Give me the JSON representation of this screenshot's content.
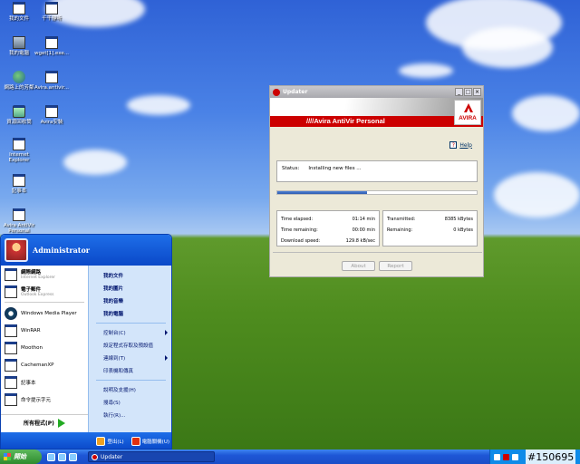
{
  "desktop": {
    "icons": [
      {
        "label": "我的文件",
        "type": "doc"
      },
      {
        "label": "千千静听",
        "type": "doc"
      },
      {
        "label": "我的電腦",
        "type": "pc"
      },
      {
        "label": "wget[1].exe...",
        "type": "doc"
      },
      {
        "label": "網路上的芳鄰",
        "type": "net"
      },
      {
        "label": "Avira.antivir...",
        "type": "doc"
      },
      {
        "label": "資源回收筒",
        "type": "bin"
      },
      {
        "label": "Avira安裝",
        "type": "doc"
      },
      {
        "label": "Internet Explorer",
        "type": "doc"
      },
      {
        "label": "記事本",
        "type": "doc"
      },
      {
        "label": "Avira AntiVir Personal Edition",
        "type": "doc"
      }
    ]
  },
  "updater": {
    "title": "Updater",
    "banner_text": "////Avira AntiVir Personal",
    "logo_text": "AVIRA",
    "help_label": "Help",
    "status_label": "Status:",
    "status_value": "Installing new files ...",
    "progress": 0.45,
    "left_rows": [
      {
        "label": "Time elapsed:",
        "value": "01:14 min"
      },
      {
        "label": "Time remaining:",
        "value": "00:00 min"
      },
      {
        "label": "Download speed:",
        "value": "129.8 kB/sec"
      }
    ],
    "right_rows": [
      {
        "label": "Transmitted:",
        "value": "8385 kBytes"
      },
      {
        "label": "Remaining:",
        "value": "0 kBytes"
      }
    ],
    "about_label": "About",
    "report_label": "Report"
  },
  "start_menu": {
    "user": "Administrator",
    "pinned": [
      {
        "title": "網際網路",
        "sub": "Internet Explorer"
      },
      {
        "title": "電子郵件",
        "sub": "Outlook Express"
      }
    ],
    "recent": [
      "Windows Media Player",
      "WinRAR",
      "Moothon",
      "CachemanXP",
      "記事本",
      "命令提示字元"
    ],
    "all_programs": "所有程式(P)",
    "right_group1": [
      "我的文件",
      "我的圖片",
      "我的音樂",
      "我的電腦"
    ],
    "right_group2": [
      "控制台(C)",
      "設定程式存取及預設值",
      "連線到(T)",
      "印表機和傳真"
    ],
    "right_group3": [
      "說明及支援(H)",
      "搜尋(S)",
      "執行(R)..."
    ],
    "logoff": "登出(L)",
    "shutdown": "電腦關機(U)"
  },
  "taskbar": {
    "start_label": "開始",
    "task_label": "Updater"
  },
  "watermark": "#150695"
}
